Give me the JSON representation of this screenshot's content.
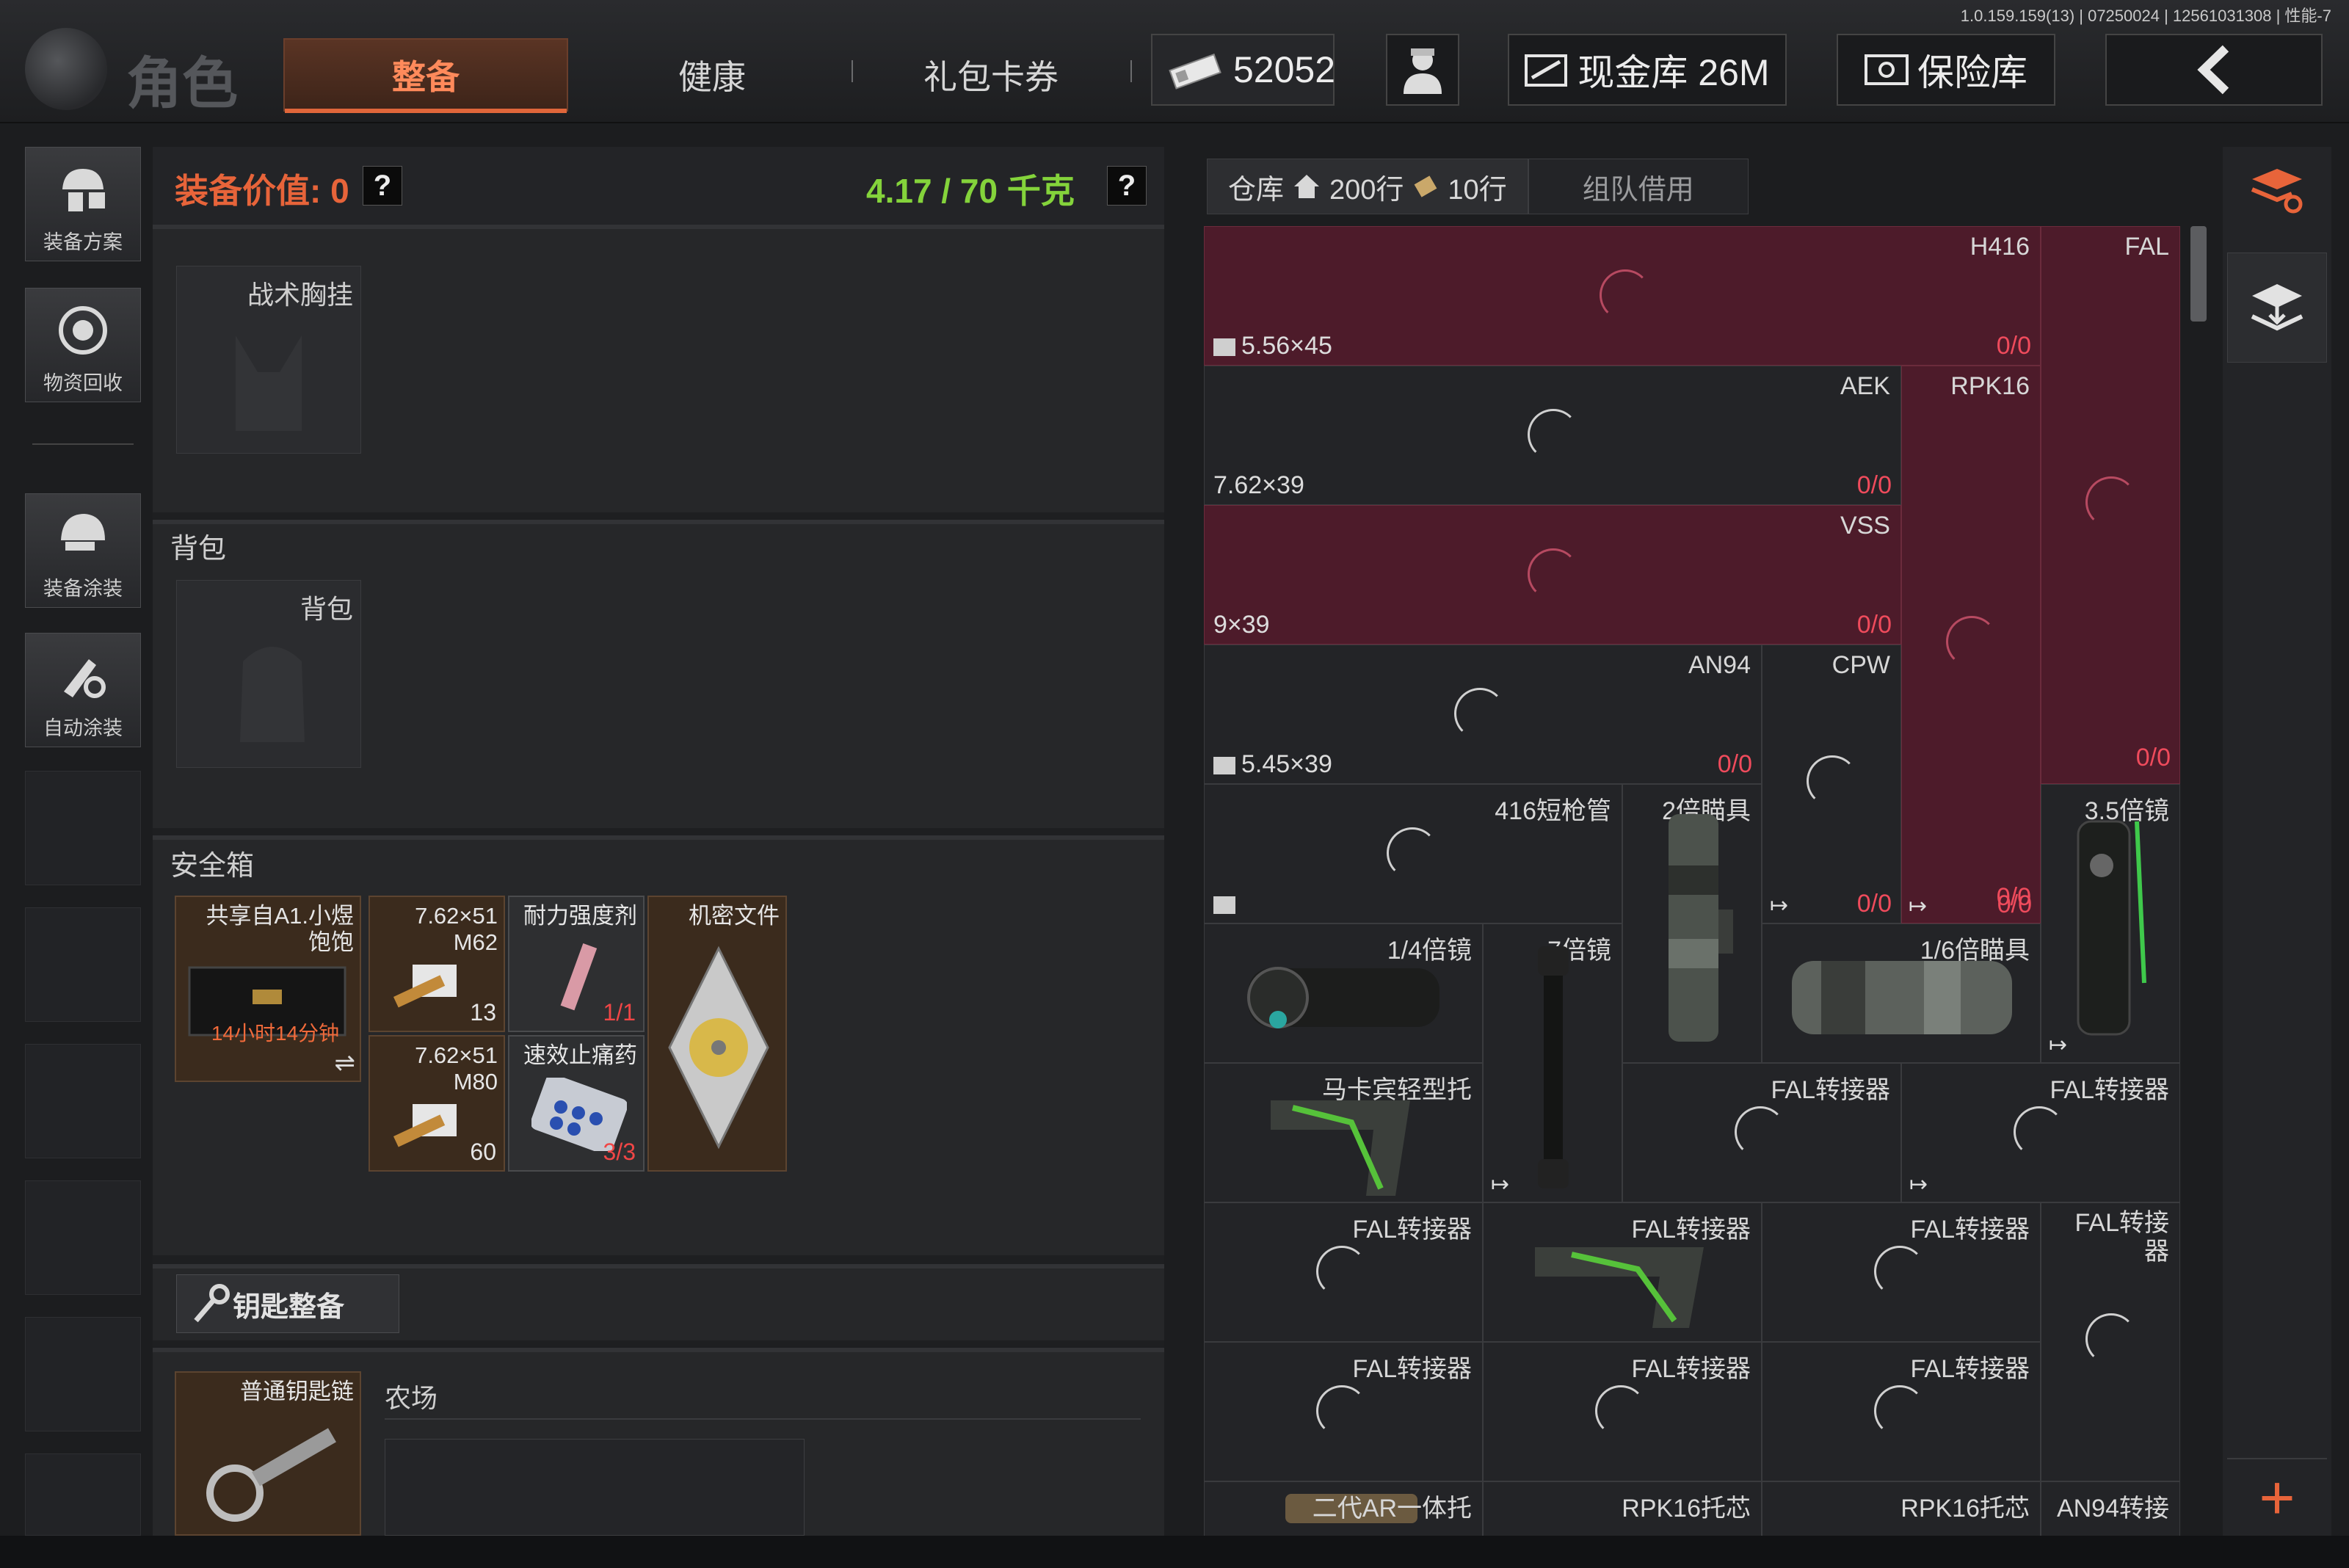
{
  "version": "1.0.159.159(13) | 07250024 | 12561031308 | 性能-7",
  "header": {
    "title": "角色",
    "tabs": {
      "equip": "整备",
      "health": "健康",
      "gift": "礼包卡券"
    },
    "cash": "52052",
    "cash_vault": "现金库 26M",
    "safe_vault": "保险库"
  },
  "sidebar": {
    "items": [
      "装备方案",
      "物资回收",
      "装备涂装",
      "自动涂装"
    ]
  },
  "equipment": {
    "value_label": "装备价值: 0",
    "weight_label": "4.17 / 70 千克",
    "help": "?",
    "chest_rig_label": "战术胸挂",
    "backpack_section": "背包",
    "backpack_label": "背包",
    "safebox_section": "安全箱",
    "safe_items": {
      "box": {
        "name": "共享自A1.小煜饱饱",
        "timer": "14小时14分钟"
      },
      "ammo1": {
        "name": "7.62×51 M62",
        "count": "13"
      },
      "stim": {
        "name": "耐力强度剂",
        "count": "1/1"
      },
      "doc": {
        "name": "机密文件"
      },
      "ammo2": {
        "name": "7.62×51 M80",
        "count": "60"
      },
      "pills": {
        "name": "速效止痛药",
        "count": "3/3"
      }
    },
    "key_button": "钥匙整备",
    "keychain_label": "普通钥匙链",
    "farm_label": "农场"
  },
  "warehouse": {
    "tab_main": "仓库",
    "rows_home": "200行",
    "rows_extra": "10行",
    "tab_team": "组队借用",
    "cells": {
      "h416": "H416",
      "fal": "FAL",
      "aek": "AEK",
      "rpk16": "RPK16",
      "vss": "VSS",
      "an94": "AN94",
      "cpw": "CPW",
      "cal_556": "5.56×45",
      "cal_762": "7.62×39",
      "cal_939": "9×39",
      "cal_545": "5.45×39",
      "zero": "0/0",
      "barrel416": "416短枪管",
      "scope2x": "2倍瞄具",
      "scope35x": "3.5倍镜",
      "scope14x": "1/4倍镜",
      "scope7x": "7倍镜",
      "scope16x": "1/6倍瞄具",
      "stock_mg": "马卡宾轻型托",
      "fal_adapter": "FAL转接器",
      "fal_adapter_wrap": "FAL转接器",
      "ar_stock": "二代AR一体托",
      "rpk_core": "RPK16托芯",
      "an94_adapter": "AN94转接"
    }
  },
  "colors": {
    "accent": "#e0663a",
    "weight_ok": "#84d33b",
    "locked_cell": "#4d1b2a",
    "count_red": "#ef4b5c"
  }
}
